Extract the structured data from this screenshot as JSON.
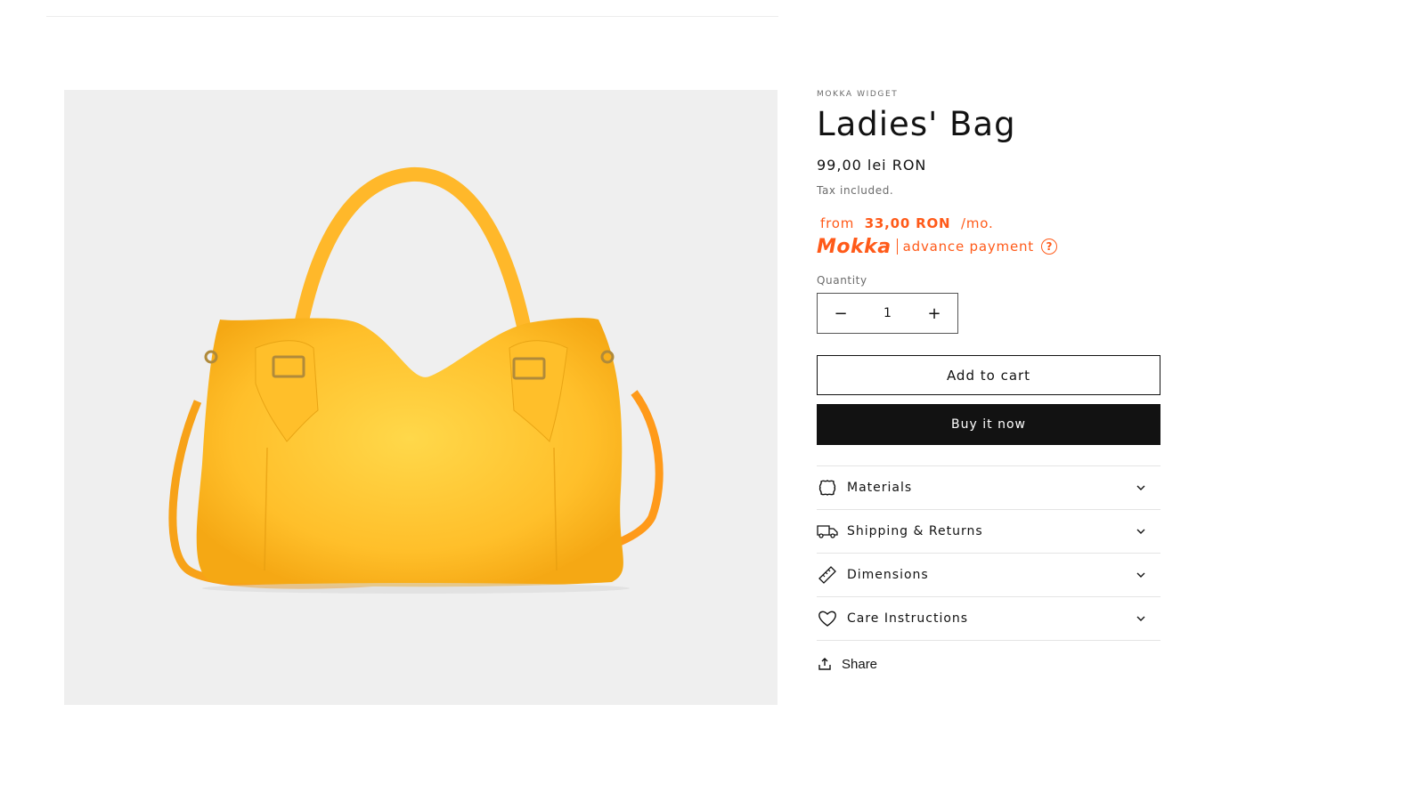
{
  "product": {
    "vendor": "MOKKA WIDGET",
    "title": "Ladies' Bag",
    "price": "99,00 lei RON",
    "tax_note": "Tax included."
  },
  "mokka": {
    "from_label": "from",
    "amount": "33,00 RON",
    "per_month": "/mo.",
    "logo_text": "Mokka",
    "advance_label": "advance payment",
    "help_glyph": "?",
    "brand_color": "#ff5a19"
  },
  "quantity": {
    "label": "Quantity",
    "value": "1",
    "decrease_glyph": "−",
    "increase_glyph": "+"
  },
  "actions": {
    "add_to_cart": "Add to cart",
    "buy_now": "Buy it now"
  },
  "accordions": [
    {
      "icon": "leather-icon",
      "label": "Materials"
    },
    {
      "icon": "truck-icon",
      "label": "Shipping & Returns"
    },
    {
      "icon": "ruler-icon",
      "label": "Dimensions"
    },
    {
      "icon": "heart-icon",
      "label": "Care Instructions"
    }
  ],
  "share": {
    "label": "Share",
    "icon": "share-icon"
  },
  "image": {
    "subject": "yellow-leather-handbag",
    "background": "#efefef"
  }
}
